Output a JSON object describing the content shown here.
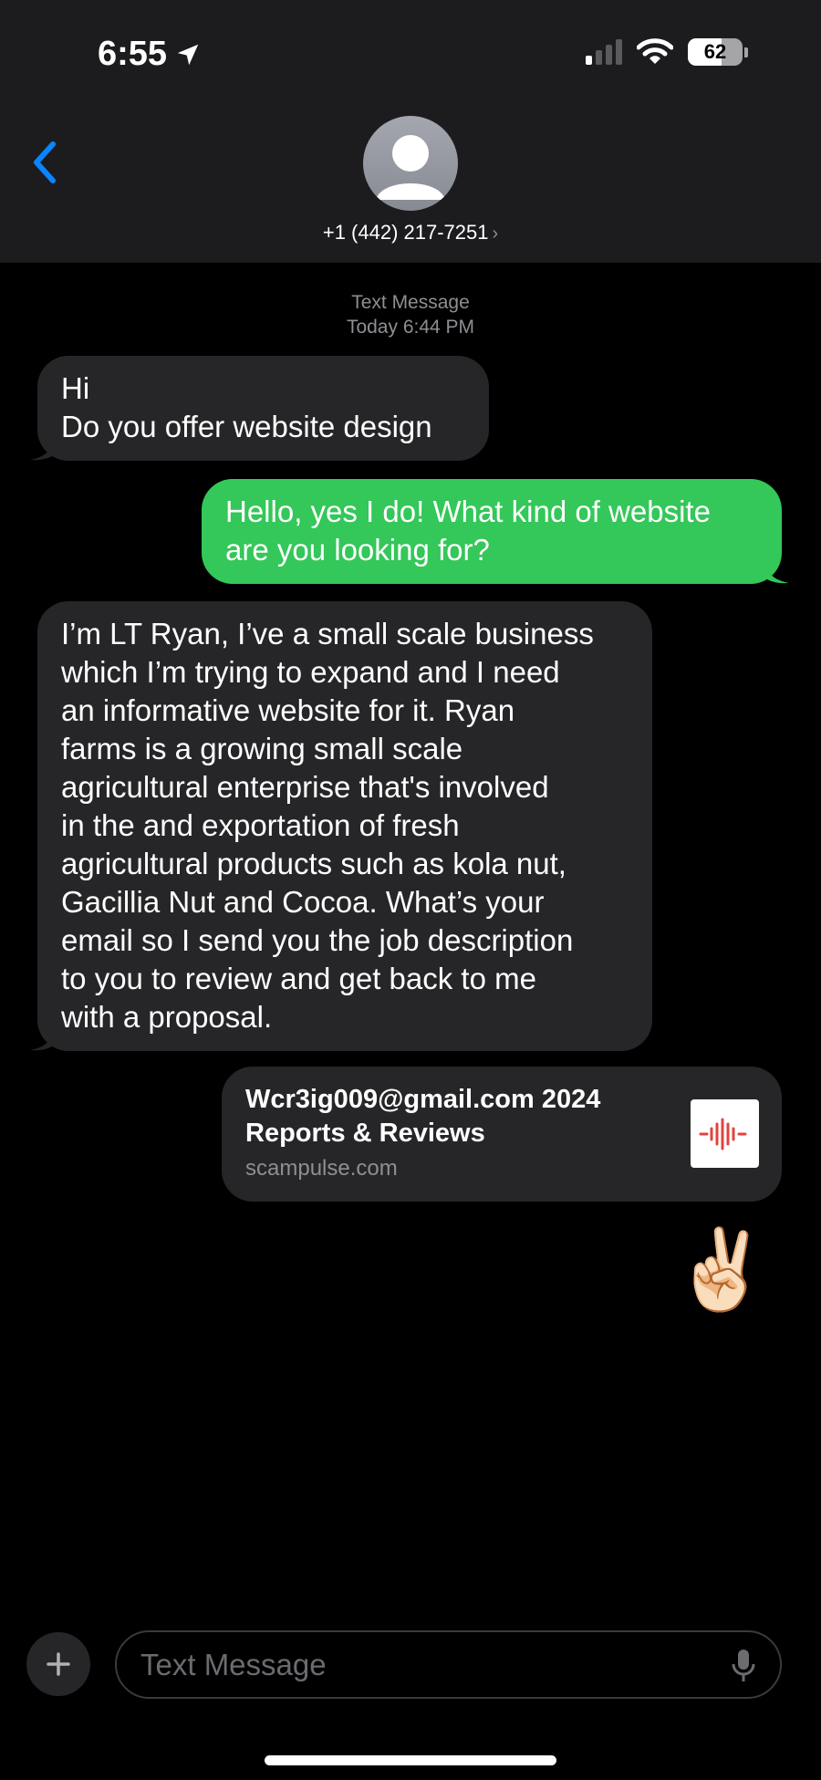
{
  "status_bar": {
    "time": "6:55",
    "battery": "62",
    "battery_level_percent": 62
  },
  "conversation": {
    "contact": "+1 (442) 217-7251"
  },
  "thread": {
    "service_label": "Text Message",
    "timestamp": "Today 6:44 PM",
    "messages": [
      {
        "direction": "received",
        "lines": [
          "Hi",
          "Do you offer website design"
        ]
      },
      {
        "direction": "sent",
        "lines": [
          "Hello, yes I do! What kind of website",
          "are you looking for?"
        ]
      },
      {
        "direction": "received",
        "lines": [
          "I’m LT Ryan, I’ve a small scale business",
          "which I’m trying to expand and I need",
          "an informative website for it. Ryan",
          "farms is a growing small scale",
          "agricultural enterprise that's involved",
          "in the and exportation of fresh",
          "agricultural products such as kola nut,",
          "Gacillia Nut and Cocoa. What’s your",
          "email so I send you the job description",
          "to you to review and get back to me",
          "with a proposal."
        ]
      }
    ],
    "link_preview": {
      "title_lines": [
        "Wcr3ig009@gmail.com 2024",
        "Reports & Reviews"
      ],
      "domain": "scampulse.com"
    },
    "emoji": "✌🏻"
  },
  "composer": {
    "placeholder": "Text Message"
  },
  "colors": {
    "sent_bubble": "#34c759",
    "received_bubble": "#262628",
    "accent": "#0a84ff"
  },
  "icons": [
    "location-arrow-icon",
    "signal-icon",
    "wifi-icon",
    "battery-icon",
    "back-chevron-icon",
    "avatar-icon",
    "plus-icon",
    "mic-icon",
    "waveform-icon"
  ]
}
